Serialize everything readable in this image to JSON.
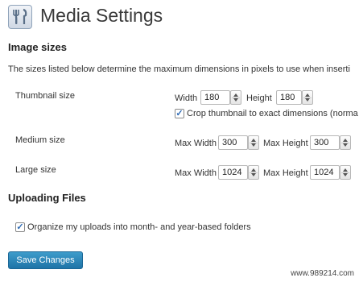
{
  "header": {
    "title": "Media Settings",
    "icon": "media-settings-icon"
  },
  "image_sizes": {
    "heading": "Image sizes",
    "description": "The sizes listed below determine the maximum dimensions in pixels to use when inserti",
    "thumbnail": {
      "label": "Thumbnail size",
      "width_label": "Width",
      "width_value": "180",
      "height_label": "Height",
      "height_value": "180",
      "crop_checked": true,
      "crop_label": "Crop thumbnail to exact dimensions (norma"
    },
    "medium": {
      "label": "Medium size",
      "max_width_label": "Max Width",
      "max_width_value": "300",
      "max_height_label": "Max Height",
      "max_height_value": "300"
    },
    "large": {
      "label": "Large size",
      "max_width_label": "Max Width",
      "max_width_value": "1024",
      "max_height_label": "Max Height",
      "max_height_value": "1024"
    }
  },
  "uploading": {
    "heading": "Uploading Files",
    "organize_checked": true,
    "organize_label": "Organize my uploads into month- and year-based folders"
  },
  "save_button": "Save Changes",
  "watermark": "www.989214.com",
  "colors": {
    "button": "#2a86bb",
    "check": "#2e6bb5"
  }
}
